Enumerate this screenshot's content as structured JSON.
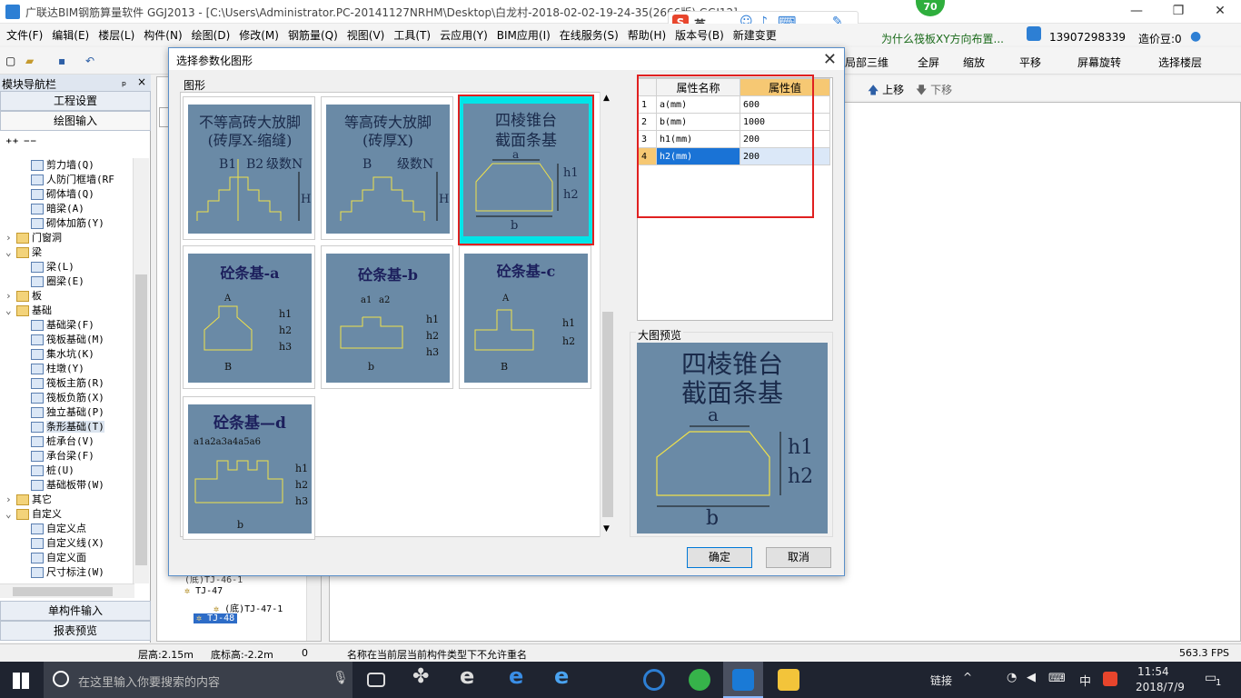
{
  "window": {
    "title": "广联达BIM钢筋算量软件 GGJ2013 - [C:\\Users\\Administrator.PC-20141127NRHM\\Desktop\\白龙村-2018-02-02-19-24-35(2666版).GGJ12]",
    "notification_badge": "70"
  },
  "menu": [
    "文件(F)",
    "编辑(E)",
    "楼层(L)",
    "构件(N)",
    "绘图(D)",
    "修改(M)",
    "钢筋量(Q)",
    "视图(V)",
    "工具(T)",
    "云应用(Y)",
    "BIM应用(I)",
    "在线服务(S)",
    "帮助(H)",
    "版本号(B)",
    "新建变更"
  ],
  "ime": {
    "lang": "英"
  },
  "right_info": {
    "question": "为什么筏板XY方向布置...",
    "phone": "13907298339",
    "beans": "造价豆:0"
  },
  "toolbar": {
    "local3d": "局部三维",
    "fullscreen": "全屏",
    "zoom": "缩放",
    "pan": "平移",
    "rotate": "屏幕旋转",
    "select_floor": "选择楼层",
    "move_up": "上移",
    "move_down": "下移"
  },
  "left_panel": {
    "title": "模块导航栏",
    "buttons": {
      "project": "工程设置",
      "draw": "绘图输入",
      "single": "单构件输入",
      "report": "报表预览"
    },
    "tree": [
      {
        "label": "剪力墙(Q)",
        "indent": 2
      },
      {
        "label": "人防门框墙(RF",
        "indent": 2
      },
      {
        "label": "砌体墙(Q)",
        "indent": 2
      },
      {
        "label": "暗梁(A)",
        "indent": 2
      },
      {
        "label": "砌体加筋(Y)",
        "indent": 2
      },
      {
        "label": "门窗洞",
        "indent": 1,
        "folder": true,
        "exp": ">"
      },
      {
        "label": "梁",
        "indent": 1,
        "folder": true,
        "exp": "v"
      },
      {
        "label": "梁(L)",
        "indent": 2
      },
      {
        "label": "圈梁(E)",
        "indent": 2
      },
      {
        "label": "板",
        "indent": 1,
        "folder": true,
        "exp": ">"
      },
      {
        "label": "基础",
        "indent": 1,
        "folder": true,
        "exp": "v"
      },
      {
        "label": "基础梁(F)",
        "indent": 2
      },
      {
        "label": "筏板基础(M)",
        "indent": 2
      },
      {
        "label": "集水坑(K)",
        "indent": 2
      },
      {
        "label": "柱墩(Y)",
        "indent": 2
      },
      {
        "label": "筏板主筋(R)",
        "indent": 2
      },
      {
        "label": "筏板负筋(X)",
        "indent": 2
      },
      {
        "label": "独立基础(P)",
        "indent": 2
      },
      {
        "label": "条形基础(T)",
        "indent": 2,
        "selected": true
      },
      {
        "label": "桩承台(V)",
        "indent": 2
      },
      {
        "label": "承台梁(F)",
        "indent": 2
      },
      {
        "label": "桩(U)",
        "indent": 2
      },
      {
        "label": "基础板带(W)",
        "indent": 2
      },
      {
        "label": "其它",
        "indent": 1,
        "folder": true,
        "exp": ">"
      },
      {
        "label": "自定义",
        "indent": 1,
        "folder": true,
        "exp": "v"
      },
      {
        "label": "自定义点",
        "indent": 2
      },
      {
        "label": "自定义线(X)",
        "indent": 2
      },
      {
        "label": "自定义面",
        "indent": 2
      },
      {
        "label": "尺寸标注(W)",
        "indent": 2
      }
    ]
  },
  "component_tree": [
    {
      "label": "(底)TJ-46-1"
    },
    {
      "label": "TJ-47"
    },
    {
      "label": "(底)TJ-47-1"
    },
    {
      "label": "TJ-48"
    }
  ],
  "dialog": {
    "title": "选择参数化图形",
    "gallery_label": "图形",
    "shapes": [
      {
        "title": "不等高砖大放脚\n(砖厚X-缩缝)",
        "labels": [
          "B1",
          "B2",
          "级数N",
          "H"
        ]
      },
      {
        "title": "等高砖大放脚\n(砖厚X)",
        "labels": [
          "B",
          "级数N",
          "H"
        ]
      },
      {
        "title": "四棱锥台\n截面条基",
        "labels": [
          "a",
          "h1",
          "h2",
          "b"
        ]
      },
      {
        "title": "砼条基-a",
        "labels": [
          "A",
          "h1",
          "h2",
          "h3",
          "B"
        ]
      },
      {
        "title": "砼条基-b",
        "labels": [
          "a1",
          "a2",
          "h1",
          "h2",
          "h3",
          "b"
        ]
      },
      {
        "title": "砼条基-c",
        "labels": [
          "A",
          "h1",
          "h2",
          "B"
        ]
      },
      {
        "title": "砼条基—d",
        "labels": [
          "a1a2a3a4a5a6",
          "h1",
          "h2",
          "h3",
          "b"
        ]
      }
    ],
    "props": {
      "col_name": "属性名称",
      "col_value": "属性值",
      "rows": [
        {
          "idx": "1",
          "name": "a(mm)",
          "value": "600"
        },
        {
          "idx": "2",
          "name": "b(mm)",
          "value": "1000"
        },
        {
          "idx": "3",
          "name": "h1(mm)",
          "value": "200"
        },
        {
          "idx": "4",
          "name": "h2(mm)",
          "value": "200"
        }
      ]
    },
    "preview": {
      "label": "大图预览",
      "title": "四棱锥台\n截面条基",
      "a": "a",
      "h1": "h1",
      "h2": "h2",
      "b": "b"
    },
    "ok": "确定",
    "cancel": "取消"
  },
  "status": {
    "floor_h": "层高:2.15m",
    "bottom_h": "底标高:-2.2m",
    "zero": "0",
    "msg": "名称在当前层当前构件类型下不允许重名",
    "fps": "563.3 FPS"
  },
  "taskbar": {
    "search": "在这里输入你要搜索的内容",
    "link": "链接",
    "lang": "中",
    "time": "11:54",
    "date": "2018/7/9",
    "notif": "1"
  }
}
